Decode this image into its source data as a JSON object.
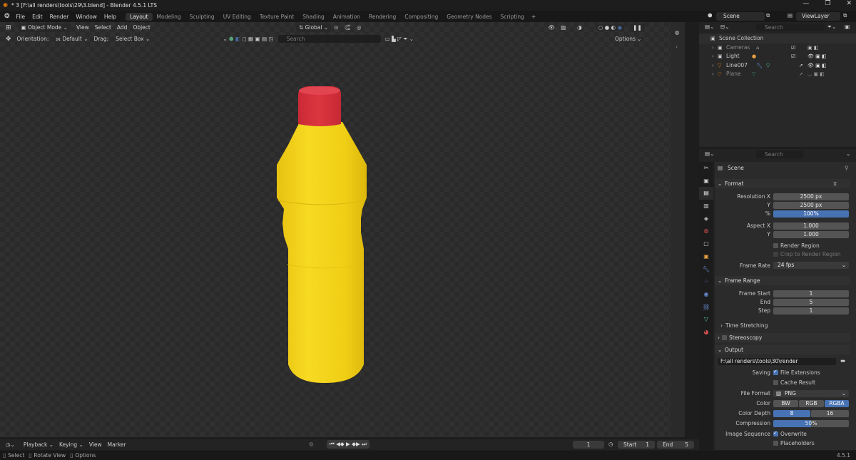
{
  "window": {
    "title": "* 3 [F:\\all renders\\tools\\29\\3.blend] - Blender 4.5.1 LTS",
    "controls": [
      "—",
      "❐",
      "✕"
    ]
  },
  "menu": [
    "File",
    "Edit",
    "Render",
    "Window",
    "Help"
  ],
  "workspaces": [
    "Layout",
    "Modeling",
    "Sculpting",
    "UV Editing",
    "Texture Paint",
    "Shading",
    "Animation",
    "Rendering",
    "Compositing",
    "Geometry Nodes",
    "Scripting"
  ],
  "scene_selector": {
    "scene": "Scene",
    "view_layer": "ViewLayer"
  },
  "viewport_header": {
    "mode": "Object Mode",
    "menus": [
      "View",
      "Select",
      "Add",
      "Object"
    ],
    "transform_orientation": "Global"
  },
  "tool_settings": {
    "orientation_label": "Orientation:",
    "orientation_value": "Default",
    "drag_label": "Drag:",
    "drag_value": "Select Box",
    "search_placeholder": "Search",
    "options": "Options"
  },
  "outliner": {
    "search_placeholder": "Search",
    "root": "Scene Collection",
    "items": [
      {
        "name": "Cameras"
      },
      {
        "name": "Light"
      },
      {
        "name": "Line007"
      },
      {
        "name": "Plane"
      }
    ]
  },
  "properties": {
    "search_placeholder": "Search",
    "context": "Scene",
    "format": {
      "header": "Format",
      "resolution_x_label": "Resolution X",
      "resolution_x": "2500 px",
      "resolution_y_label": "Y",
      "resolution_y": "2500 px",
      "percent_label": "%",
      "percent": "100%",
      "aspect_x_label": "Aspect X",
      "aspect_x": "1.000",
      "aspect_y_label": "Y",
      "aspect_y": "1.000",
      "render_region": "Render Region",
      "crop": "Crop to Render Region",
      "frame_rate_label": "Frame Rate",
      "frame_rate": "24 fps"
    },
    "frame_range": {
      "header": "Frame Range",
      "start_label": "Frame Start",
      "start": "1",
      "end_label": "End",
      "end": "5",
      "step_label": "Step",
      "step": "1",
      "time_stretching": "Time Stretching"
    },
    "stereoscopy": "Stereoscopy",
    "output": {
      "header": "Output",
      "path": "F:\\all renders\\tools\\30\\render",
      "saving_label": "Saving",
      "file_extensions": "File Extensions",
      "cache_result": "Cache Result",
      "file_format_label": "File Format",
      "file_format": "PNG",
      "color_label": "Color",
      "color_options": [
        "BW",
        "RGB",
        "RGBA"
      ],
      "color_selected": "RGBA",
      "depth_label": "Color Depth",
      "depth_options": [
        "8",
        "16"
      ],
      "depth_selected": "8",
      "compression_label": "Compression",
      "compression": "50%",
      "compression_value": 0.5,
      "sequence_label": "Image Sequence",
      "overwrite": "Overwrite",
      "placeholders": "Placeholders"
    }
  },
  "timeline": {
    "menus": [
      "Playback",
      "Keying",
      "View",
      "Marker"
    ],
    "current_frame": "1",
    "start_label": "Start",
    "start": "1",
    "end_label": "End",
    "end": "5"
  },
  "statusbar": {
    "hints": [
      "Select",
      "Rotate View",
      "Options"
    ],
    "version": "4.5.1"
  },
  "colors": {
    "accent": "#4772b3",
    "bottle_body": "#f2d21a",
    "bottle_cap": "#d8323e"
  }
}
